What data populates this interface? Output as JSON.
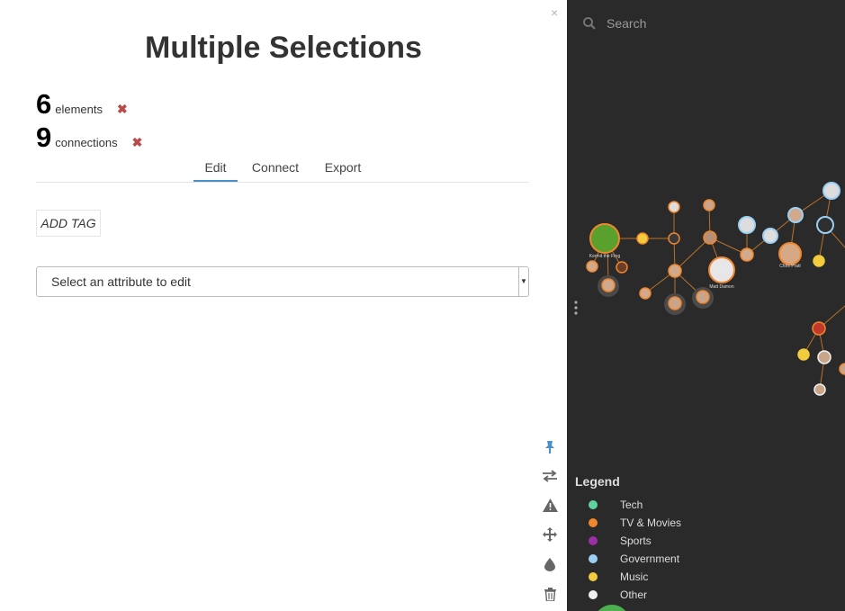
{
  "panel": {
    "title": "Multiple Selections",
    "elements_count": "6",
    "elements_label": "elements",
    "connections_count": "9",
    "connections_label": "connections",
    "remove_glyph": "✖",
    "close_glyph": "×",
    "tabs": [
      {
        "label": "Edit",
        "active": true
      },
      {
        "label": "Connect",
        "active": false
      },
      {
        "label": "Export",
        "active": false
      }
    ],
    "add_tag_label": "ADD TAG",
    "attribute_select": {
      "value": "Select an attribute to edit"
    }
  },
  "toolbar": {
    "tools": [
      "pin-icon",
      "swap-arrows-icon",
      "warning-icon",
      "move-icon",
      "drop-icon",
      "trash-icon"
    ]
  },
  "map": {
    "search_placeholder": "Search",
    "node_labels": {
      "kermit": "Kermit the Frog",
      "matt": "Matt Damon",
      "chris": "Chris Pratt"
    },
    "legend": {
      "title": "Legend",
      "items": [
        {
          "label": "Tech",
          "color": "#5fd3a0"
        },
        {
          "label": "TV & Movies",
          "color": "#f0862e"
        },
        {
          "label": "Sports",
          "color": "#9b2fa5"
        },
        {
          "label": "Government",
          "color": "#9bd0f5"
        },
        {
          "label": "Music",
          "color": "#f2cc3d"
        },
        {
          "label": "Other",
          "color": "#f2f2f2"
        }
      ]
    }
  }
}
